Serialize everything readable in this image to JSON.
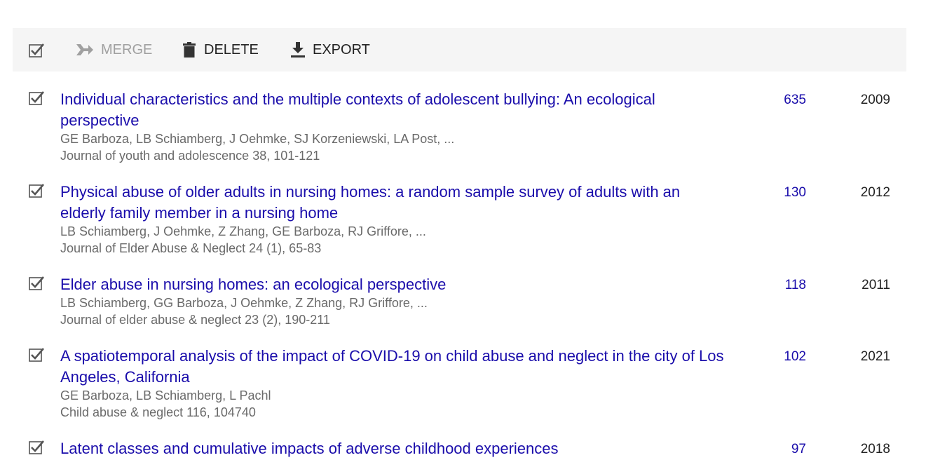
{
  "toolbar": {
    "merge_label": "MERGE",
    "delete_label": "DELETE",
    "export_label": "EXPORT"
  },
  "articles": [
    {
      "title": "Individual characteristics and the multiple contexts of adolescent bullying: An ecological perspective",
      "authors": "GE Barboza, LB Schiamberg, J Oehmke, SJ Korzeniewski, LA Post, ...",
      "venue": "Journal of youth and adolescence 38, 101-121",
      "cited_by": "635",
      "year": "2009",
      "checked": true
    },
    {
      "title": "Physical abuse of older adults in nursing homes: a random sample survey of adults with an elderly family member in a nursing home",
      "authors": "LB Schiamberg, J Oehmke, Z Zhang, GE Barboza, RJ Griffore, ...",
      "venue": "Journal of Elder Abuse & Neglect 24 (1), 65-83",
      "cited_by": "130",
      "year": "2012",
      "checked": true
    },
    {
      "title": "Elder abuse in nursing homes: an ecological perspective",
      "authors": "LB Schiamberg, GG Barboza, J Oehmke, Z Zhang, RJ Griffore, ...",
      "venue": "Journal of elder abuse & neglect 23 (2), 190-211",
      "cited_by": "118",
      "year": "2011",
      "checked": true
    },
    {
      "title": "A spatiotemporal analysis of the impact of COVID-19 on child abuse and neglect in the city of Los Angeles, California",
      "authors": "GE Barboza, LB Schiamberg, L Pachl",
      "venue": "Child abuse & neglect 116, 104740",
      "cited_by": "102",
      "year": "2021",
      "checked": true
    },
    {
      "title": "Latent classes and cumulative impacts of adverse childhood experiences",
      "authors": "",
      "venue": "",
      "cited_by": "97",
      "year": "2018",
      "checked": true
    }
  ]
}
